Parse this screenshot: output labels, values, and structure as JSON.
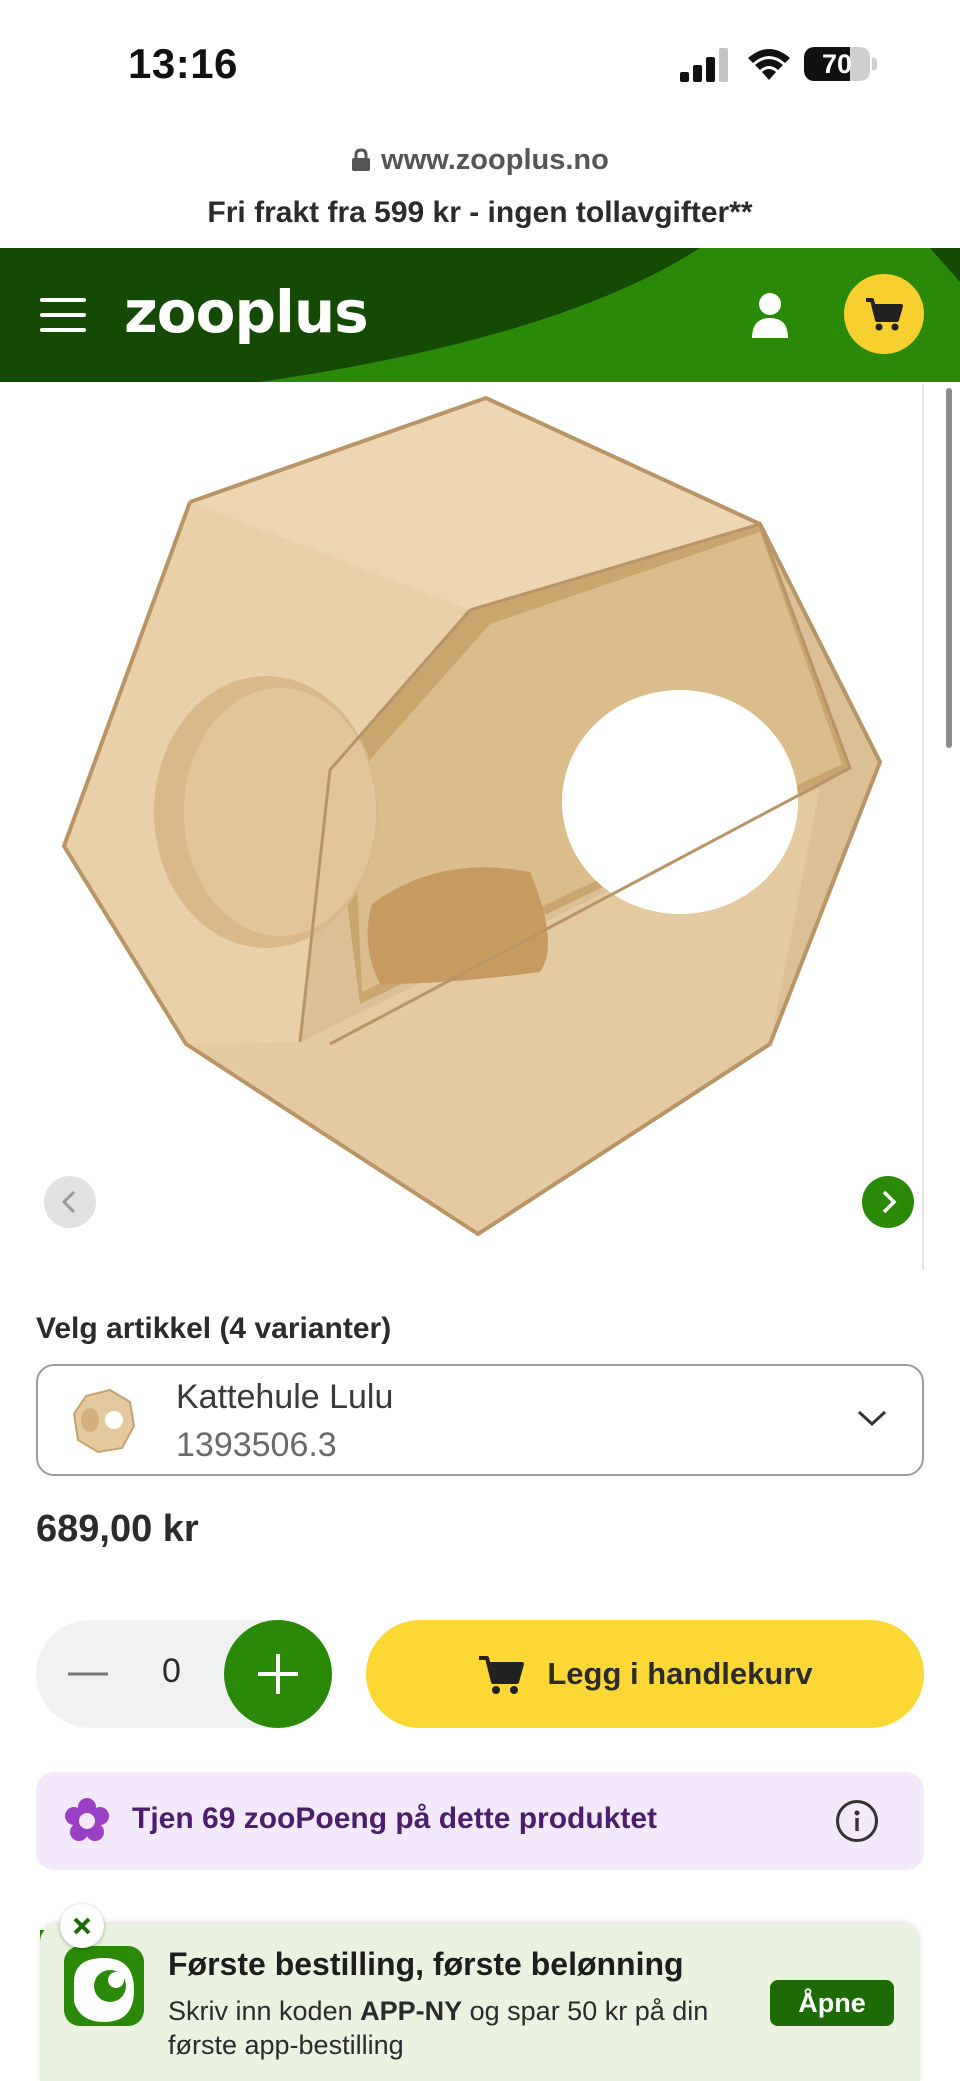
{
  "status_bar": {
    "time": "13:16",
    "battery": "70",
    "battery_level_percent": 70,
    "icons": [
      "signal-icon",
      "wifi-icon",
      "battery-icon"
    ]
  },
  "browser": {
    "url": "www.zooplus.no"
  },
  "promo": {
    "text": "Fri frakt fra 599 kr - ingen tollavgifter**"
  },
  "header": {
    "logo": "zooplus",
    "brand_color": "#2a8a08",
    "dark_color": "#144a04",
    "cart_color": "#f7cf2e",
    "icons": [
      "menu-icon",
      "user-icon",
      "cart-icon"
    ]
  },
  "product": {
    "variant_title": "Velg artikkel (4 varianter)",
    "selected_variant": {
      "name": "Kattehule Lulu",
      "sku": "1393506.3"
    },
    "price": "689,00 kr",
    "quantity": "0",
    "add_to_cart_label": "Legg i handlekurv",
    "add_to_cart_color": "#fdd835",
    "points_text": "Tjen 69 zooPoeng på dette produktet",
    "points_color": "#4b1f6e"
  },
  "app_banner": {
    "title": "Første bestilling, første belønning",
    "body_prefix": "Skriv inn koden ",
    "code": "APP-NY",
    "body_suffix": " og spar 50 kr på din første app-bestilling",
    "open_label": "Åpne"
  }
}
